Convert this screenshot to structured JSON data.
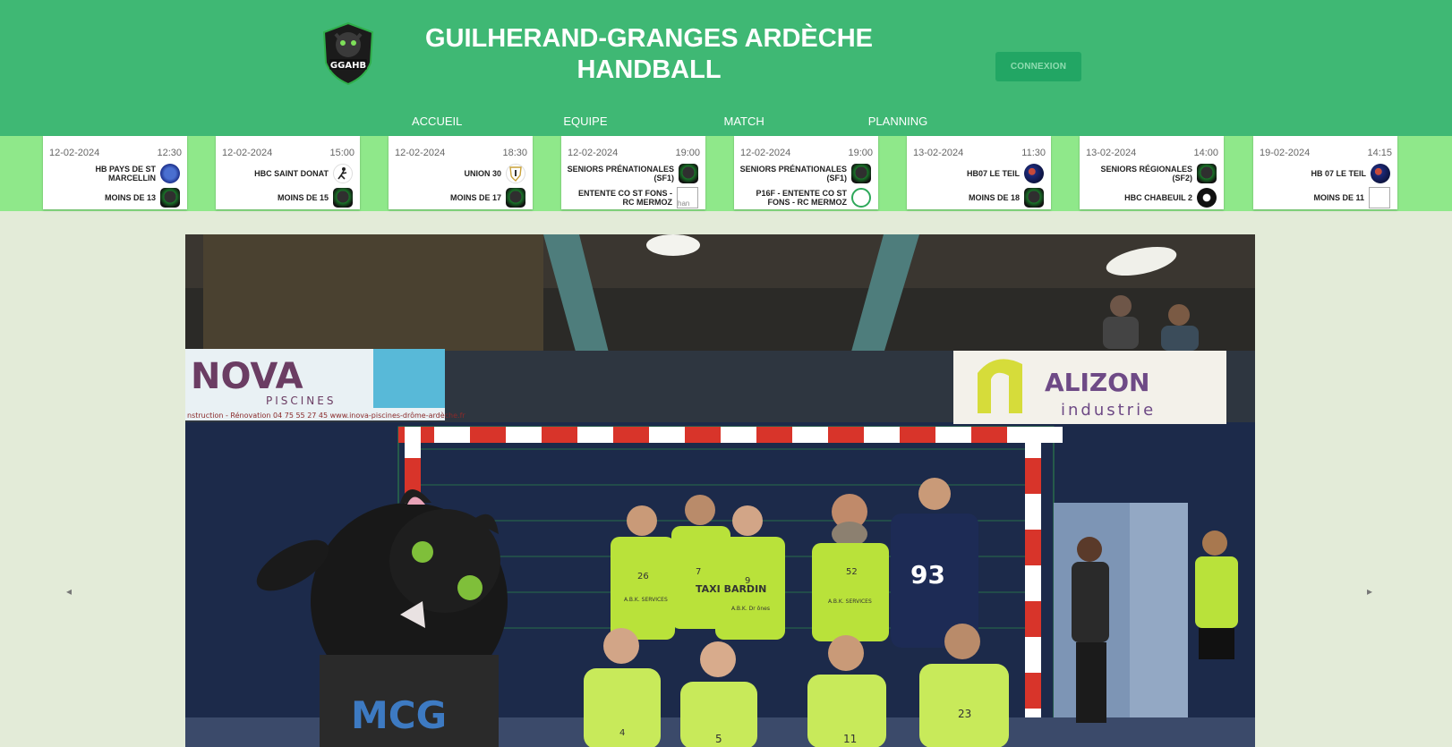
{
  "header": {
    "title_line1": "GUILHERAND-GRANGES ARDÈCHE",
    "title_line2": "HANDBALL",
    "logo_text": "GGAHB",
    "login_label": "CONNEXION"
  },
  "nav": {
    "items": [
      {
        "label": "ACCUEIL"
      },
      {
        "label": "EQUIPE"
      },
      {
        "label": "MATCH"
      },
      {
        "label": "PLANNING"
      }
    ]
  },
  "matches": [
    {
      "date": "12-02-2024",
      "time": "12:30",
      "home": "HB PAYS DE ST MARCELLIN",
      "away": "MOINS DE 13",
      "home_badge": "blue-club-icon",
      "away_badge": "ggahb-icon"
    },
    {
      "date": "12-02-2024",
      "time": "15:00",
      "home": "HBC SAINT DONAT",
      "away": "MOINS DE 15",
      "home_badge": "player-silhouette-icon",
      "away_badge": "ggahb-icon"
    },
    {
      "date": "12-02-2024",
      "time": "18:30",
      "home": "UNION 30",
      "away": "MOINS DE 17",
      "home_badge": "shield-trophy-icon",
      "away_badge": "ggahb-icon"
    },
    {
      "date": "12-02-2024",
      "time": "19:00",
      "home": "SENIORS PRÉNATIONALES (SF1)",
      "away": "ENTENTE CO ST FONS - RC MERMOZ",
      "home_badge": "ggahb-icon",
      "away_badge": "broken-image-icon",
      "away_alt": "han"
    },
    {
      "date": "12-02-2024",
      "time": "19:00",
      "home": "SENIORS PRÉNATIONALES (SF1)",
      "away": "P16F - ENTENTE CO ST FONS - RC MERMOZ",
      "home_badge": "ggahb-icon",
      "away_badge": "green-ring-icon"
    },
    {
      "date": "13-02-2024",
      "time": "11:30",
      "home": "HB07 LE TEIL",
      "away": "MOINS DE 18",
      "home_badge": "navy-club-icon",
      "away_badge": "ggahb-icon"
    },
    {
      "date": "13-02-2024",
      "time": "14:00",
      "home": "SENIORS RÉGIONALES (SF2)",
      "away": "HBC CHABEUIL 2",
      "home_badge": "ggahb-icon",
      "away_badge": "black-club-icon"
    },
    {
      "date": "19-02-2024",
      "time": "14:15",
      "home": "HB 07 LE TEIL",
      "away": "MOINS DE 11",
      "home_badge": "navy-club-icon",
      "away_badge": "broken-image-icon",
      "away_alt": ""
    }
  ],
  "hero": {
    "banner_left_brand": "NOVA",
    "banner_left_sub": "PISCINES",
    "banner_left_contact": "nstruction - Rénovation   04 75 55 27 45   www.inova-piscines-drôme-ardèche.fr",
    "banner_right_brand": "ALIZON",
    "banner_right_sub": "industrie",
    "jersey_numbers": [
      "26",
      "7",
      "9",
      "52",
      "93",
      "4",
      "5",
      "11",
      "23"
    ],
    "mascot_shirt": "MCG",
    "sponsor_shirt_1": "A.B.K. SERVICES",
    "sponsor_shirt_2": "TAXI BARDIN",
    "sponsor_shirt_3": "A.B.K. Dr ônes"
  },
  "carousel": {
    "prev_symbol": "◂",
    "next_symbol": "▸"
  }
}
